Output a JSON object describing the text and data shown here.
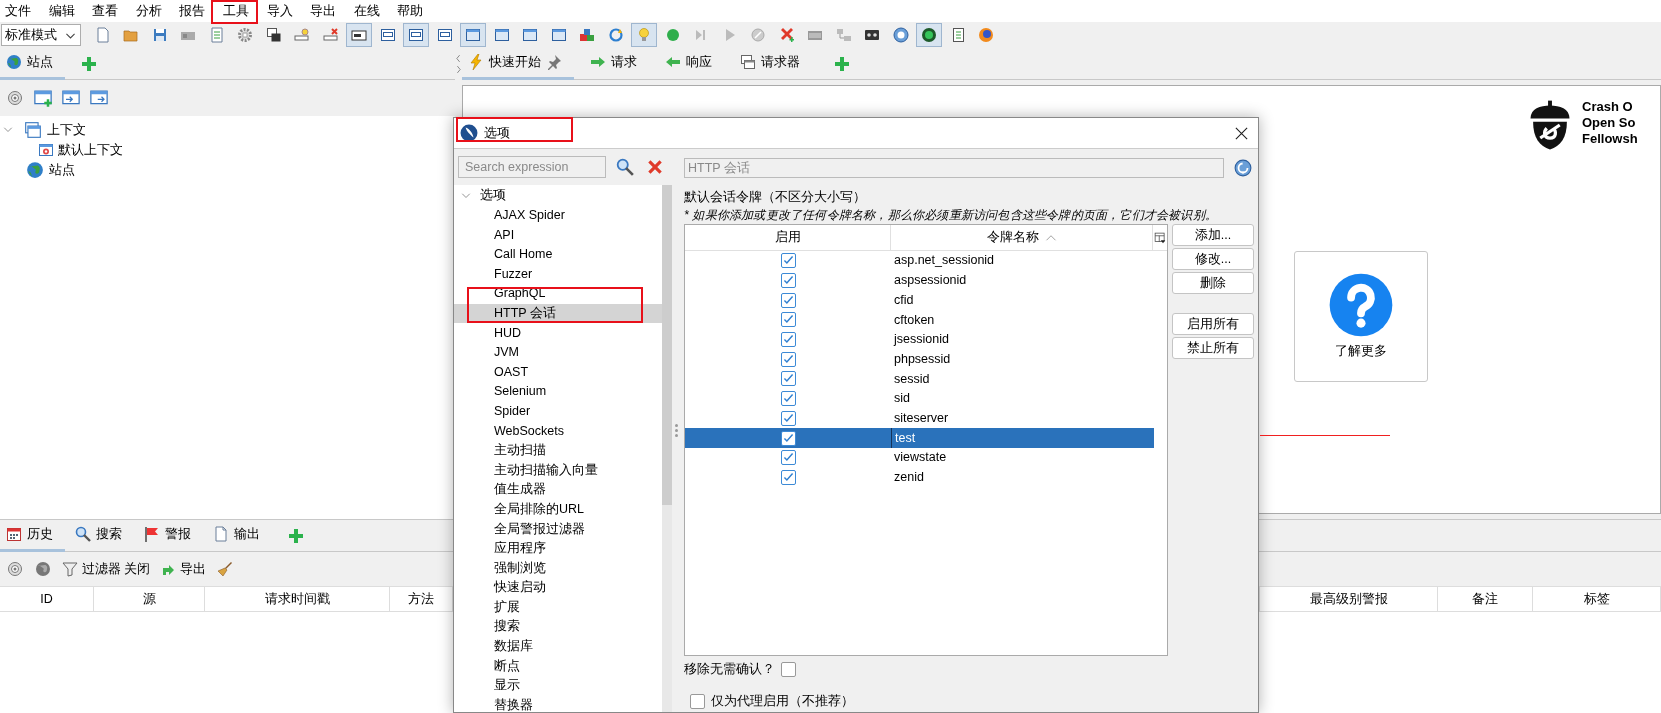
{
  "menu": [
    "文件",
    "编辑",
    "查看",
    "分析",
    "报告",
    "工具",
    "导入",
    "导出",
    "在线",
    "帮助"
  ],
  "mode_select": {
    "value": "标准模式"
  },
  "toolbar": [
    {
      "kind": "document",
      "pressed": false
    },
    {
      "kind": "folder",
      "pressed": false
    },
    {
      "kind": "disk",
      "pressed": false
    },
    {
      "kind": "camera",
      "pressed": false
    },
    {
      "kind": "sheet",
      "pressed": false
    },
    {
      "kind": "gear",
      "pressed": false
    },
    {
      "kind": "windows",
      "pressed": false
    },
    {
      "kind": "pin",
      "pressed": false
    },
    {
      "kind": "pinx",
      "pressed": false
    },
    {
      "kind": "tag",
      "pressed": true
    },
    {
      "kind": "layout",
      "pressed": false
    },
    {
      "kind": "layout",
      "pressed": true
    },
    {
      "kind": "layout",
      "pressed": false
    },
    {
      "kind": "panel",
      "pressed": true
    },
    {
      "kind": "panel",
      "pressed": false
    },
    {
      "kind": "panel",
      "pressed": false
    },
    {
      "kind": "panel",
      "pressed": false
    },
    {
      "kind": "blocks",
      "pressed": false
    },
    {
      "kind": "refresh",
      "pressed": false
    },
    {
      "kind": "bulb",
      "pressed": true
    },
    {
      "kind": "dot",
      "pressed": false
    },
    {
      "kind": "step",
      "pressed": false
    },
    {
      "kind": "play",
      "pressed": false
    },
    {
      "kind": "stop",
      "pressed": false
    },
    {
      "kind": "cross",
      "pressed": false
    },
    {
      "kind": "keyboard",
      "pressed": false
    },
    {
      "kind": "network",
      "pressed": false
    },
    {
      "kind": "tape",
      "pressed": false
    },
    {
      "kind": "help",
      "pressed": false
    },
    {
      "kind": "eye",
      "pressed": true
    },
    {
      "kind": "notebook",
      "pressed": false
    },
    {
      "kind": "browser",
      "pressed": false
    }
  ],
  "sites_panel": {
    "tabs": [
      {
        "label": "站点",
        "kind": "globe",
        "selected": true
      }
    ],
    "tree": [
      {
        "label": "上下文",
        "kind": "contexts",
        "expanded": true,
        "children": [
          {
            "label": "默认上下文",
            "kind": "context"
          }
        ]
      },
      {
        "label": "站点",
        "kind": "globe"
      }
    ]
  },
  "workspace": {
    "tabs": [
      {
        "label": "快速开始",
        "kind": "bolt",
        "selected": true
      },
      {
        "label": "请求",
        "kind": "arrowR",
        "selected": false
      },
      {
        "label": "响应",
        "kind": "arrowL",
        "selected": false
      },
      {
        "label": "请求器",
        "kind": "windows",
        "selected": false
      }
    ],
    "logo_text": [
      "Crash O",
      "Open So",
      "Fellowsh"
    ],
    "learn_more": "了解更多"
  },
  "bottom_panel": {
    "tabs": [
      {
        "label": "历史",
        "kind": "calendar",
        "selected": true
      },
      {
        "label": "搜索",
        "kind": "search",
        "selected": false
      },
      {
        "label": "警报",
        "kind": "flag",
        "selected": false
      },
      {
        "label": "输出",
        "kind": "document",
        "selected": false
      }
    ],
    "filter_label": "过滤器 关闭",
    "export_label": "导出",
    "columns": [
      "ID",
      "源",
      "请求时间戳",
      "方法",
      "最高级别警报",
      "备注",
      "标签"
    ]
  },
  "dialog": {
    "title": "选项",
    "search": {
      "placeholder": "Search expression"
    },
    "tree": {
      "label": "选项",
      "expanded": true,
      "children": [
        {
          "label": "AJAX Spider",
          "selected": false
        },
        {
          "label": "API",
          "selected": false
        },
        {
          "label": "Call Home",
          "selected": false
        },
        {
          "label": "Fuzzer",
          "selected": false
        },
        {
          "label": "GraphQL",
          "selected": false
        },
        {
          "label": "HTTP 会话",
          "selected": true
        },
        {
          "label": "HUD",
          "selected": false
        },
        {
          "label": "JVM",
          "selected": false
        },
        {
          "label": "OAST",
          "selected": false
        },
        {
          "label": "Selenium",
          "selected": false
        },
        {
          "label": "Spider",
          "selected": false
        },
        {
          "label": "WebSockets",
          "selected": false
        },
        {
          "label": "主动扫描",
          "selected": false
        },
        {
          "label": "主动扫描输入向量",
          "selected": false
        },
        {
          "label": "值生成器",
          "selected": false
        },
        {
          "label": "全局排除的URL",
          "selected": false
        },
        {
          "label": "全局警报过滤器",
          "selected": false
        },
        {
          "label": "应用程序",
          "selected": false
        },
        {
          "label": "强制浏览",
          "selected": false
        },
        {
          "label": "快速启动",
          "selected": false
        },
        {
          "label": "扩展",
          "selected": false
        },
        {
          "label": "搜索",
          "selected": false
        },
        {
          "label": "数据库",
          "selected": false
        },
        {
          "label": "断点",
          "selected": false
        },
        {
          "label": "显示",
          "selected": false
        },
        {
          "label": "替换器",
          "selected": false
        }
      ]
    },
    "panel_title": "HTTP 会话",
    "section_title": "默认会话令牌（不区分大小写）",
    "note": "* 如果你添加或更改了任何令牌名称，那么你必须重新访问包含这些令牌的页面，它们才会被识别。",
    "table": {
      "columns": [
        "启用",
        "令牌名称"
      ],
      "rows": [
        {
          "enabled": true,
          "name": "asp.net_sessionid",
          "selected": false
        },
        {
          "enabled": true,
          "name": "aspsessionid",
          "selected": false
        },
        {
          "enabled": true,
          "name": "cfid",
          "selected": false
        },
        {
          "enabled": true,
          "name": "cftoken",
          "selected": false
        },
        {
          "enabled": true,
          "name": "jsessionid",
          "selected": false
        },
        {
          "enabled": true,
          "name": "phpsessid",
          "selected": false
        },
        {
          "enabled": true,
          "name": "sessid",
          "selected": false
        },
        {
          "enabled": true,
          "name": "sid",
          "selected": false
        },
        {
          "enabled": true,
          "name": "siteserver",
          "selected": false
        },
        {
          "enabled": true,
          "name": "test",
          "selected": true
        },
        {
          "enabled": true,
          "name": "viewstate",
          "selected": false
        },
        {
          "enabled": true,
          "name": "zenid",
          "selected": false
        }
      ]
    },
    "button_groups": [
      [
        "添加...",
        "修改...",
        "删除"
      ],
      [
        "启用所有",
        "禁止所有"
      ]
    ],
    "confirm_remove": {
      "label": "移除无需确认？",
      "checked": false
    },
    "proxy_only": {
      "label": "仅为代理启用（不推荐）",
      "checked": false
    }
  }
}
